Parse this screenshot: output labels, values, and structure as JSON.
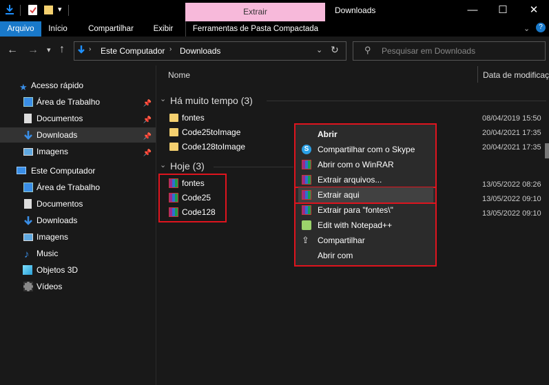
{
  "window": {
    "title": "Downloads",
    "context_tab": "Extrair",
    "colors": {
      "context_tab_bg": "#f7b9da",
      "accent": "#1979ca",
      "highlight_box": "#e0141e"
    }
  },
  "ribbon": {
    "tabs": [
      "Arquivo",
      "Início",
      "Compartilhar",
      "Exibir",
      "Ferramentas de Pasta Compactada"
    ]
  },
  "address": {
    "path": [
      "Este Computador",
      "Downloads"
    ],
    "search_placeholder": "Pesquisar em Downloads"
  },
  "sidebar": {
    "quick_access": "Acesso rápido",
    "quick_items": [
      "Área de Trabalho",
      "Documentos",
      "Downloads",
      "Imagens"
    ],
    "computer": "Este Computador",
    "computer_items": [
      "Área de Trabalho",
      "Documentos",
      "Downloads",
      "Imagens",
      "Music",
      "Objetos 3D",
      "Vídeos"
    ]
  },
  "content": {
    "col_name": "Nome",
    "col_date": "Data de modificaç",
    "group_old": {
      "label": "Há muito tempo (3)",
      "files": [
        {
          "name": "fontes",
          "date": "08/04/2019 15:50"
        },
        {
          "name": "Code25toImage",
          "date": "20/04/2021 17:35"
        },
        {
          "name": "Code128toImage",
          "date": "20/04/2021 17:35"
        }
      ]
    },
    "group_today": {
      "label": "Hoje (3)",
      "files": [
        {
          "name": "fontes",
          "date": "13/05/2022 08:26"
        },
        {
          "name": "Code25",
          "date": "13/05/2022 09:10"
        },
        {
          "name": "Code128",
          "date": "13/05/2022 09:10"
        }
      ]
    }
  },
  "context_menu": {
    "items": [
      "Abrir",
      "Compartilhar com o Skype",
      "Abrir com o WinRAR",
      "Extrair arquivos...",
      "Extrair aqui",
      "Extrair para \"fontes\\\"",
      "Edit with Notepad++",
      "Compartilhar",
      "Abrir com"
    ]
  }
}
